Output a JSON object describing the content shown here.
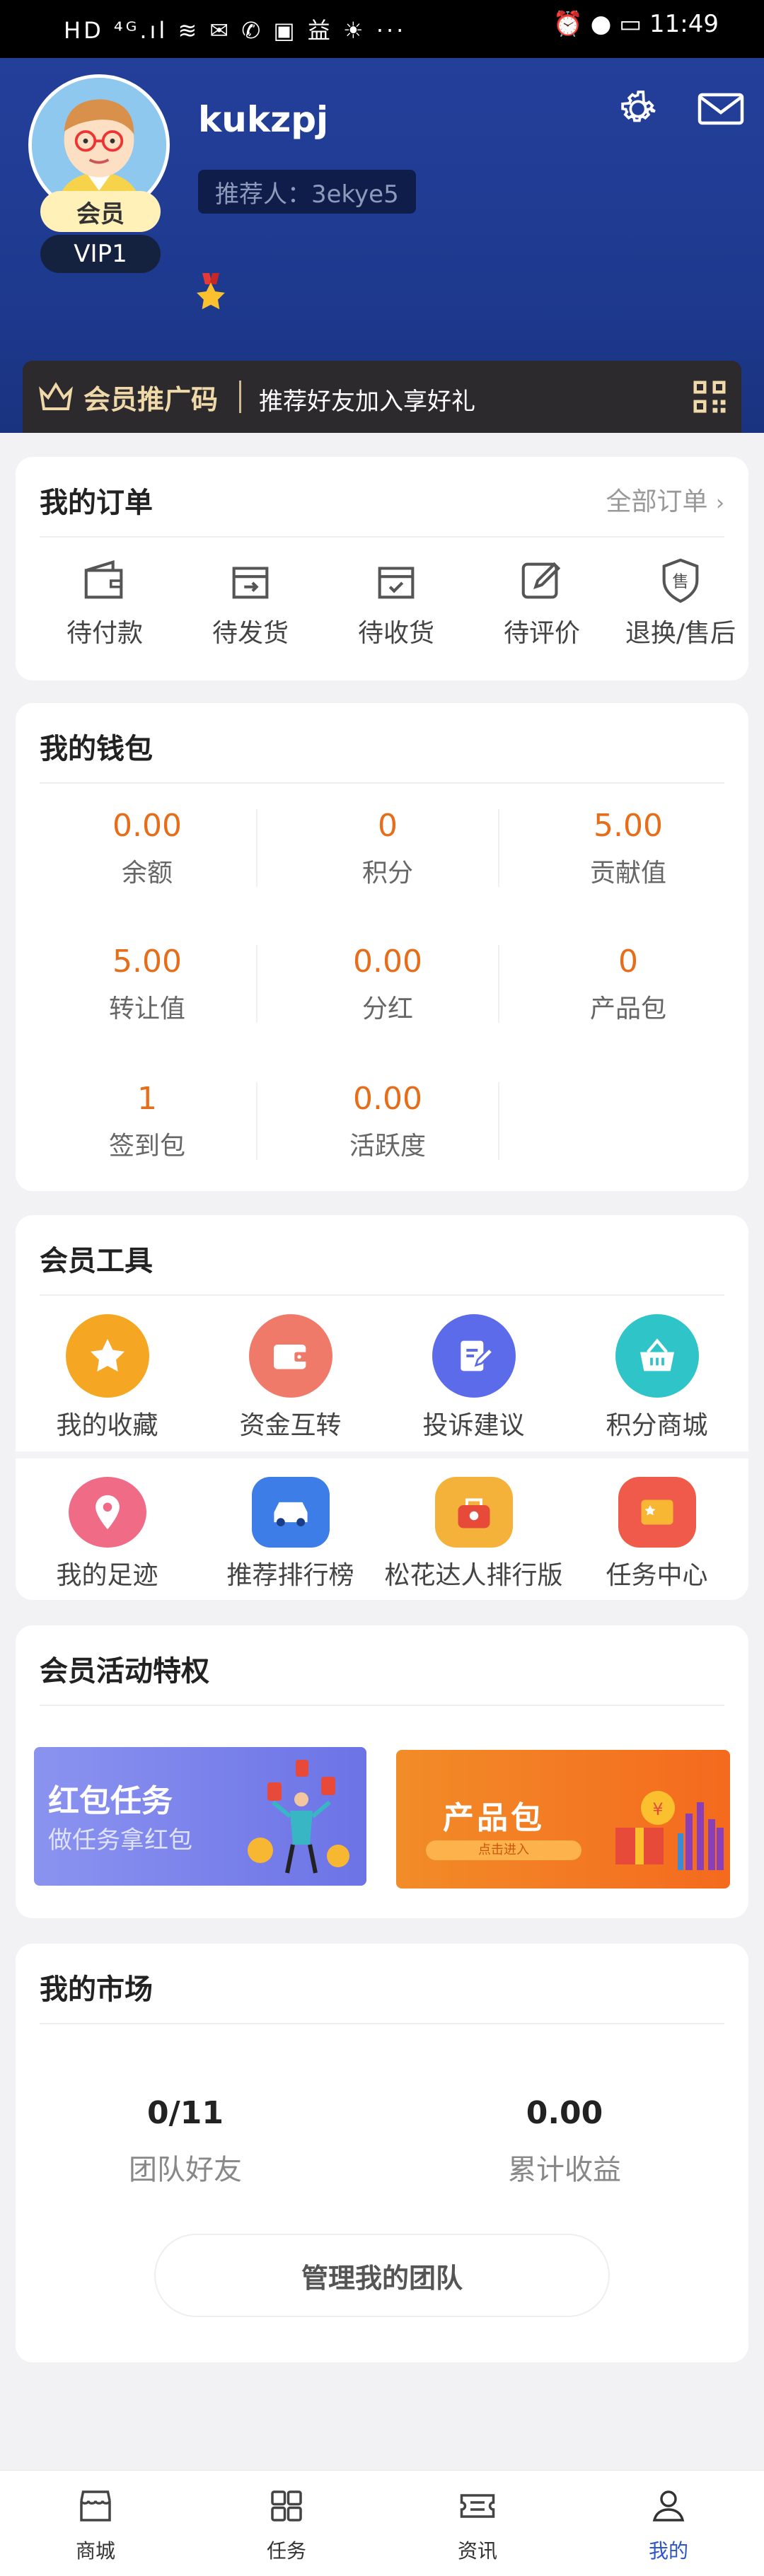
{
  "status_bar": {
    "left": "HD ⁴ᴳ.ıl ≋ ✉ ✆ ▣ 益 ☀ ···",
    "right": "⏰ ● ▭ 11:49",
    "time": "11:49"
  },
  "profile": {
    "username": "kukzpj",
    "member_label": "会员",
    "vip_label": "VIP1",
    "referrer": "推荐人：3ekye5"
  },
  "promo": {
    "title": "会员推广码",
    "subtitle": "推荐好友加入享好礼"
  },
  "orders": {
    "title": "我的订单",
    "all_link": "全部订单",
    "items": [
      {
        "label": "待付款",
        "icon": "wallet-icon"
      },
      {
        "label": "待发货",
        "icon": "ship-box-icon"
      },
      {
        "label": "待收货",
        "icon": "receive-box-icon"
      },
      {
        "label": "待评价",
        "icon": "edit-icon"
      },
      {
        "label": "退换/售后",
        "icon": "after-sale-icon"
      }
    ]
  },
  "wallet": {
    "title": "我的钱包",
    "items": [
      {
        "value": "0.00",
        "label": "余额"
      },
      {
        "value": "0",
        "label": "积分"
      },
      {
        "value": "5.00",
        "label": "贡献值"
      },
      {
        "value": "5.00",
        "label": "转让值"
      },
      {
        "value": "0.00",
        "label": "分红"
      },
      {
        "value": "0",
        "label": "产品包"
      },
      {
        "value": "1",
        "label": "签到包"
      },
      {
        "value": "0.00",
        "label": "活跃度"
      }
    ]
  },
  "tools": {
    "title": "会员工具",
    "items": [
      {
        "label": "我的收藏",
        "icon": "star-icon",
        "color": "#f5a623"
      },
      {
        "label": "资金互转",
        "icon": "transfer-wallet-icon",
        "color": "#f07a6a"
      },
      {
        "label": "投诉建议",
        "icon": "feedback-icon",
        "color": "#5b6bea"
      },
      {
        "label": "积分商城",
        "icon": "basket-icon",
        "color": "#2fc4c8"
      },
      {
        "label": "我的足迹",
        "icon": "location-pin-icon",
        "color": "#f06b86"
      },
      {
        "label": "推荐排行榜",
        "icon": "car-icon",
        "color": "#3d7de8"
      },
      {
        "label": "松花达人排行版",
        "icon": "bag-icon",
        "color": "#f5b23a"
      },
      {
        "label": "任务中心",
        "icon": "task-card-icon",
        "color": "#f05a4a"
      }
    ]
  },
  "activities": {
    "title": "会员活动特权",
    "banners": [
      {
        "title": "红包任务",
        "subtitle": "做任务拿红包"
      },
      {
        "title": "产品包",
        "subtitle": "点击进入"
      }
    ]
  },
  "market": {
    "title": "我的市场",
    "stats": [
      {
        "value": "0/11",
        "label": "团队好友"
      },
      {
        "value": "0.00",
        "label": "累计收益"
      }
    ],
    "button": "管理我的团队"
  },
  "tabbar": [
    {
      "label": "商城",
      "icon": "shop-icon"
    },
    {
      "label": "任务",
      "icon": "grid-icon"
    },
    {
      "label": "资讯",
      "icon": "ticket-icon"
    },
    {
      "label": "我的",
      "icon": "user-icon"
    }
  ],
  "colors": {
    "header_blue": "#1e3a8f",
    "accent_orange": "#e66d1a",
    "active_tab": "#2d56c9"
  }
}
